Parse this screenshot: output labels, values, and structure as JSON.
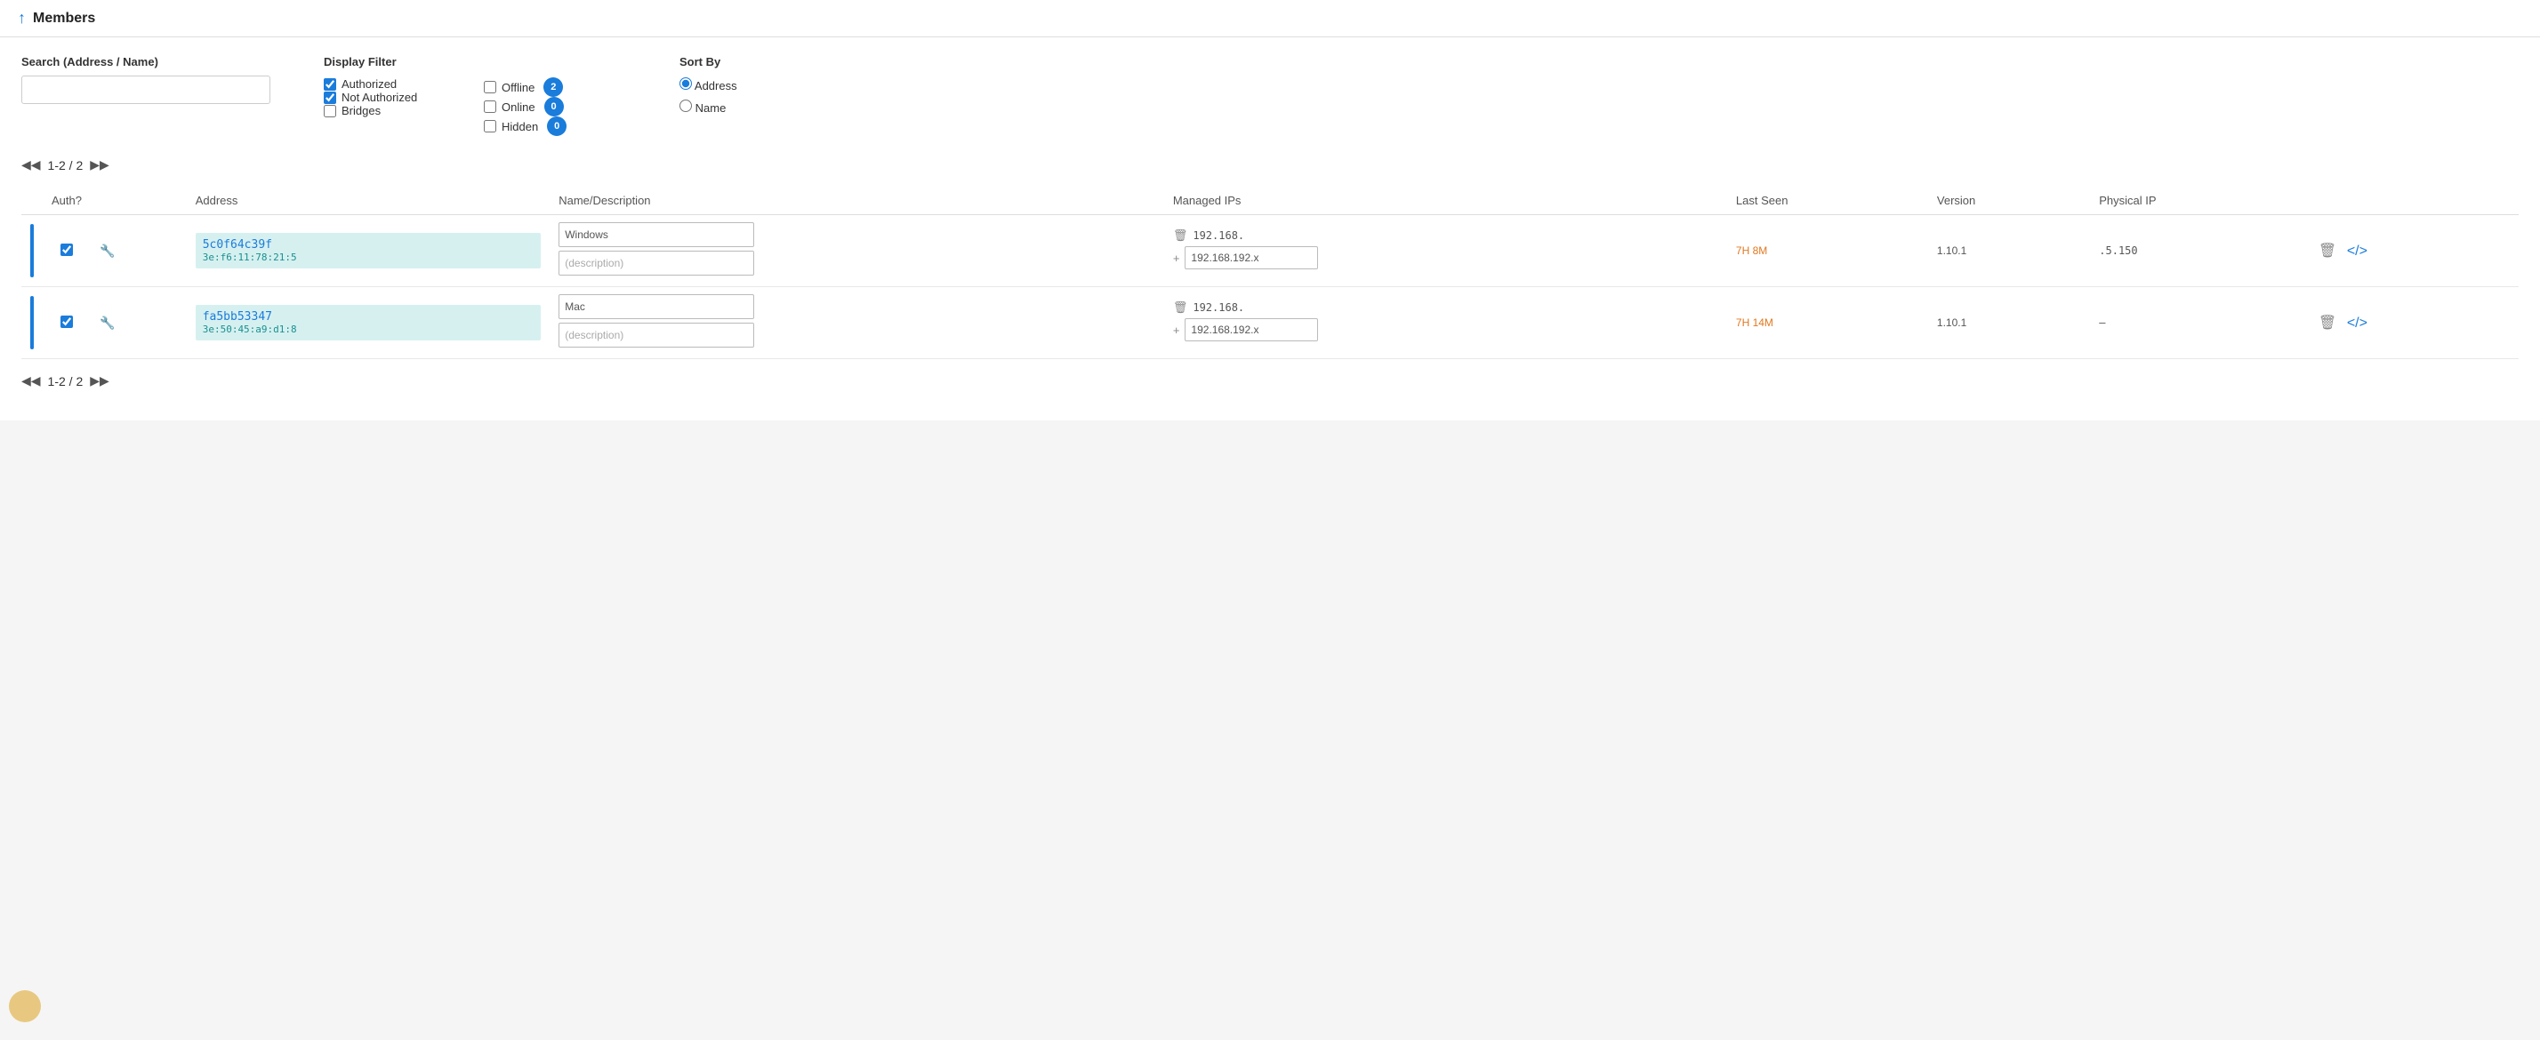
{
  "header": {
    "arrow": "↑",
    "title": "Members"
  },
  "search": {
    "label": "Search (Address / Name)",
    "placeholder": "",
    "value": ""
  },
  "display_filter": {
    "label": "Display Filter",
    "options": [
      {
        "id": "authorized",
        "label": "Authorized",
        "checked": true
      },
      {
        "id": "not-authorized",
        "label": "Not Authorized",
        "checked": true
      },
      {
        "id": "bridges",
        "label": "Bridges",
        "checked": false
      },
      {
        "id": "offline",
        "label": "Offline",
        "checked": false,
        "badge": "2"
      },
      {
        "id": "online",
        "label": "Online",
        "checked": false,
        "badge": "0"
      },
      {
        "id": "hidden",
        "label": "Hidden",
        "checked": false,
        "badge": "0"
      }
    ]
  },
  "sort_by": {
    "label": "Sort By",
    "options": [
      {
        "id": "address",
        "label": "Address",
        "selected": true
      },
      {
        "id": "name",
        "label": "Name",
        "selected": false
      }
    ]
  },
  "pagination": {
    "text": "1-2 / 2",
    "prev_double": "◀◀",
    "next_double": "▶▶"
  },
  "table": {
    "headers": [
      "Auth?",
      "Address",
      "Name/Description",
      "Managed IPs",
      "Last Seen",
      "Version",
      "Physical IP",
      ""
    ],
    "rows": [
      {
        "checked": true,
        "address_main": "5c0f64c39f",
        "address_sub": "3e:f6:11:78:21:5",
        "name": "Windows",
        "description": "(description)",
        "managed_ip": "192.168.",
        "managed_ip_input": "192.168.192.x",
        "last_seen": "7H 8M",
        "version": "1.10.1",
        "physical_ip": ".5.150"
      },
      {
        "checked": true,
        "address_main": "fa5bb53347",
        "address_sub": "3e:50:45:a9:d1:8",
        "name": "Mac",
        "description": "(description)",
        "managed_ip": "192.168.",
        "managed_ip_input": "192.168.192.x",
        "last_seen": "7H 14M",
        "version": "1.10.1",
        "physical_ip": "–"
      }
    ]
  },
  "bottom_pagination": {
    "text": "1-2 / 2"
  },
  "icons": {
    "wrench": "🔧",
    "delete": "🗑",
    "code": "⟨/⟩",
    "plus": "+",
    "trash": "🗑"
  }
}
